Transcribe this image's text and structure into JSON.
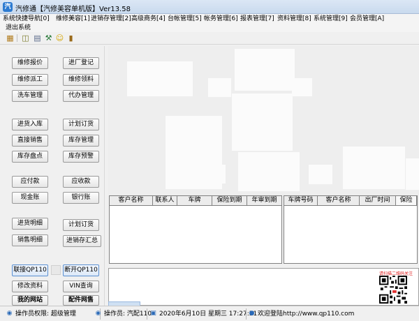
{
  "window": {
    "title": "汽修通【汽修美容单机版】Ver13.58"
  },
  "menu": {
    "row1": [
      "系统快捷导航[0]",
      "维修美容[1]",
      "进销存管理[2]",
      "高级商务[4]",
      "台帐管理[5]",
      "帐务管理[6]",
      "报表管理[7]",
      "资料管理[8]",
      "系统管理[9]",
      "会员管理[A]"
    ],
    "row2": [
      "退出系统"
    ]
  },
  "toolbar": {
    "icons": [
      "box-icon",
      "clipboard-icon",
      "document-icon",
      "tools-icon",
      "smiley-icon",
      "exit-door-icon"
    ]
  },
  "left_buttons": {
    "repair_quote": "维修报价",
    "check_in": "进厂登记",
    "repair_dispatch": "维修派工",
    "repair_materials": "维修领料",
    "car_wash": "洗车管理",
    "agency": "代办管理",
    "purchase_in": "进货入库",
    "plan_order_1": "计划订货",
    "direct_sale": "直接销售",
    "inventory": "库存管理",
    "stocktake": "库存盘点",
    "stock_alert": "库存预警",
    "payable": "应付款",
    "receivable": "应收款",
    "cash_account": "现金账",
    "bank_account": "银行账",
    "purchase_detail": "进货明细",
    "plan_order_2": "计划订货",
    "sales_detail": "销售明细",
    "inventory_summary": "进销存汇总",
    "connect_qp": "联接QP110",
    "disconnect_qp": "断开QP110",
    "edit_profile": "修改资料",
    "vin_query": "VIN查询",
    "my_site": "我的网站",
    "parts_online": "配件网售"
  },
  "grid_left": {
    "columns": [
      "客户名称",
      "联系人",
      "车牌",
      "保险到期",
      "年审到期"
    ]
  },
  "grid_right": {
    "columns": [
      "车牌号码",
      "客户名称",
      "出厂时间",
      "保险"
    ]
  },
  "qr": {
    "label": "请扫描二维码关注"
  },
  "statusbar": {
    "operator_role": "操作员权限: 超级管理",
    "operator_name": "操作员: 汽配110",
    "datetime": "2020年6月10日  星期三  17:27:51",
    "welcome": "欢迎登陆http://www.qp110.com"
  }
}
